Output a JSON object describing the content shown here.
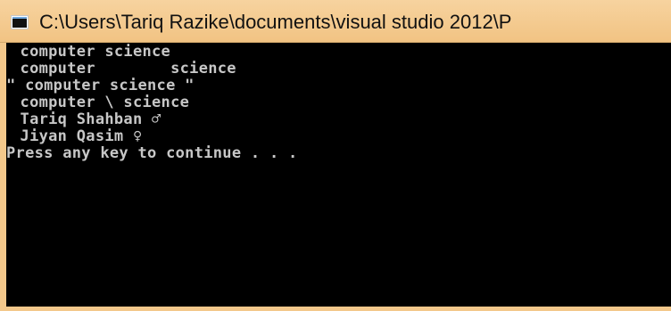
{
  "window": {
    "title": "C:\\Users\\Tariq Razike\\documents\\visual studio 2012\\P"
  },
  "console": {
    "lines": [
      " computer science",
      " computer        science",
      "\" computer science \"",
      " computer \\ science",
      " Tariq Shahban ♂",
      " Jiyan Qasim ♀",
      "Press any key to continue . . ."
    ],
    "background": "#000000",
    "foreground": "#c7c7c7"
  },
  "icons": {
    "app_icon": "console-window-icon"
  }
}
